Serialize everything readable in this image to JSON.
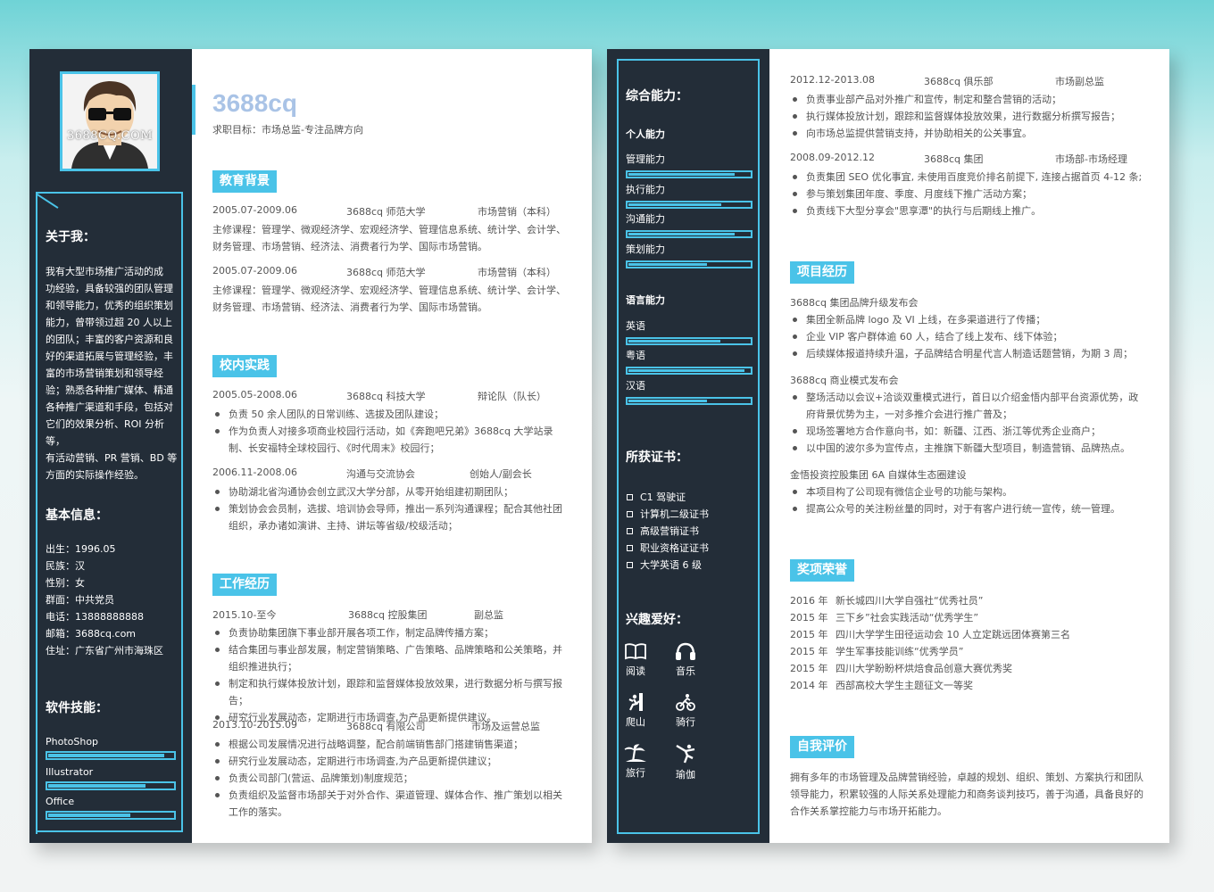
{
  "avatar": {
    "watermark": "3688CQ.COM"
  },
  "header": {
    "name": "3688cq",
    "objective": "求职目标：市场总监-专注品牌方向"
  },
  "about": {
    "title": "关于我：",
    "lines": [
      "我有大型市场推广活动的成",
      "功经验，具备较强的团队管理",
      "和领导能力，优秀的组织策划",
      "能力，曾带领过超 20 人以上",
      "的团队；丰富的客户资源和良",
      "好的渠道拓展与管理经验，丰",
      "富的市场营销策划和领导经",
      "验；熟悉各种推广媒体、精通",
      "各种推广渠道和手段，包括对",
      "它们的效果分析、ROI 分析等，",
      "有活动营销、PR 营销、BD 等",
      "方面的实际操作经验。"
    ]
  },
  "basic": {
    "title": "基本信息：",
    "lines": [
      "出生：1996.05",
      "民族：汉",
      "性别：女",
      "群面：中共党员",
      "电话：13888888888",
      "邮箱：3688cq.com",
      "住址：广东省广州市海珠区"
    ]
  },
  "software": {
    "title": "软件技能：",
    "items": [
      {
        "label": "PhotoShop",
        "level": 0.93
      },
      {
        "label": "Illustrator",
        "level": 0.78
      },
      {
        "label": "Office",
        "level": 0.66
      }
    ]
  },
  "education": {
    "title": "教育背景",
    "entries": [
      {
        "date": "2005.07-2009.06",
        "org": "3688cq 师范大学",
        "role": "市场营销（本科）",
        "lines": [
          "主修课程：管理学、微观经济学、宏观经济学、管理信息系统、统计学、会计学、",
          "财务管理、市场营销、经济法、消费者行为学、国际市场营销。"
        ]
      },
      {
        "date": "2005.07-2009.06",
        "org": "3688cq 师范大学",
        "role": "市场营销（本科）",
        "lines": [
          "主修课程：管理学、微观经济学、宏观经济学、管理信息系统、统计学、会计学、",
          "财务管理、市场营销、经济法、消费者行为学、国际市场营销。"
        ]
      }
    ]
  },
  "campus": {
    "title": "校内实践",
    "entries": [
      {
        "date": "2005.05-2008.06",
        "org": "3688cq 科技大学",
        "role": "辩论队（队长）",
        "bullets": [
          "负责 50 余人团队的日常训练、选拔及团队建设；",
          "作为负责人对接多项商业校园行活动，如《奔跑吧兄弟》3688cq 大学站录制、长安福特全球校园行、《时代周末》校园行；"
        ]
      },
      {
        "date": "2006.11-2008.06",
        "org": "沟通与交流协会",
        "role": "创始人/副会长",
        "bullets": [
          "协助湖北省沟通协会创立武汉大学分部，从零开始组建初期团队；",
          "策划协会会员制，选拔、培训协会导师，推出一系列沟通课程；配合其他社团组织，承办诸如演讲、主持、讲坛等省级/校级活动；"
        ]
      }
    ]
  },
  "work": {
    "title": "工作经历",
    "entries": [
      {
        "date": "2015.10-至今",
        "org": "3688cq 控股集团",
        "role": "副总监",
        "bullets": [
          "负责协助集团旗下事业部开展各项工作，制定品牌传播方案；",
          "结合集团与事业部发展，制定营销策略、广告策略、品牌策略和公关策略，并组织推进执行；",
          "制定和执行媒体投放计划，跟踪和监督媒体投放效果，进行数据分析与撰写报告；",
          "研究行业发展动态，定期进行市场调查,为产品更新提供建议。"
        ]
      },
      {
        "date": "2013.10-2015.09",
        "org": "3688cq 有限公司",
        "role": "市场及运营总监",
        "bullets": [
          "根据公司发展情况进行战略调整，配合前端销售部门搭建销售渠道；",
          "研究行业发展动态，定期进行市场调查,为产品更新提供建议；",
          "负责公司部门(营运、品牌策划)制度规范；",
          "负责组织及监督市场部关于对外合作、渠道管理、媒体合作、推广策划以相关工作的落实。"
        ]
      }
    ]
  },
  "work2": {
    "entries": [
      {
        "date": "2012.12-2013.08",
        "org": "3688cq 俱乐部",
        "role": "市场副总监",
        "bullets": [
          "负责事业部产品对外推广和宣传，制定和整合营销的活动；",
          "执行媒体投放计划，跟踪和监督媒体投放效果，进行数据分析撰写报告；",
          "向市场总监提供营销支持，并协助相关的公关事宜。"
        ]
      },
      {
        "date": "2008.09-2012.12",
        "org": "3688cq 集团",
        "role": "市场部-市场经理",
        "bullets": [
          "负责集团 SEO 优化事宜, 未使用百度竞价排名前提下, 连接占据首页 4-12 条;",
          "参与策划集团年度、季度、月度线下推广活动方案；",
          "负责线下大型分享会\"思享潭\"的执行与后期线上推广。"
        ]
      }
    ]
  },
  "projects": {
    "title": "项目经历",
    "entries": [
      {
        "name": "3688cq 集团品牌升级发布会",
        "bullets": [
          "集团全新品牌 logo 及 VI 上线，在多渠道进行了传播；",
          "企业 VIP 客户群体逾 60 人，结合了线上发布、线下体验；",
          "后续媒体报道持续升温，子品牌结合明星代言人制造话题营销，为期 3 周；"
        ]
      },
      {
        "name": "3688cq 商业模式发布会",
        "bullets": [
          "整场活动以会议+洽谈双重模式进行，首日以介绍金悟内部平台资源优势，政府背景优势为主，一对多推介会进行推广普及；",
          "现场签署地方合作意向书，如：新疆、江西、浙江等优秀企业商户；",
          "以中国的波尔多为宣传点，主推旗下新疆大型项目，制造营销、品牌热点。"
        ]
      },
      {
        "name": "金悟投资控股集团 6A 自媒体生态圈建设",
        "bullets": [
          "本项目构了公司现有微信企业号的功能与架构。",
          "提高公众号的关注粉丝量的同时，对于有客户进行统一宣传，统一管理。"
        ]
      }
    ]
  },
  "awards": {
    "title": "奖项荣誉",
    "items": [
      {
        "year": "2016 年",
        "text": "新长城四川大学自强社“优秀社员”"
      },
      {
        "year": "2015 年",
        "text": "三下乡”社会实践活动“优秀学生”"
      },
      {
        "year": "2015 年",
        "text": "四川大学学生田径运动会 10 人立定跳远团体赛第三名"
      },
      {
        "year": "2015 年",
        "text": "学生军事技能训练“优秀学员”"
      },
      {
        "year": "2015 年",
        "text": "四川大学盼盼杯烘焙食品创意大赛优秀奖"
      },
      {
        "year": "2014 年",
        "text": "西部高校大学生主题征文一等奖"
      }
    ]
  },
  "selfEval": {
    "title": "自我评价",
    "lines": [
      "拥有多年的市场管理及品牌营销经验，卓越的规划、组织、策划、方案执行和团队",
      "领导能力，积累较强的人际关系处理能力和商务谈判技巧，善于沟通，具备良好的",
      "合作关系掌控能力与市场开拓能力。"
    ]
  },
  "abilities": {
    "title": "综合能力：",
    "personal": {
      "title": "个人能力",
      "items": [
        {
          "label": "管理能力",
          "level": 0.88
        },
        {
          "label": "执行能力",
          "level": 0.77
        },
        {
          "label": "沟通能力",
          "level": 0.88
        },
        {
          "label": "策划能力",
          "level": 0.65
        }
      ]
    },
    "language": {
      "title": "语言能力",
      "items": [
        {
          "label": "英语",
          "level": 0.76
        },
        {
          "label": "粤语",
          "level": 0.96
        },
        {
          "label": "汉语",
          "level": 0.65
        }
      ]
    }
  },
  "certs": {
    "title": "所获证书：",
    "items": [
      "C1 驾驶证",
      "计算机二级证书",
      "高级营销证书",
      "职业资格证证书",
      "大学英语 6 级"
    ]
  },
  "hobbies": {
    "title": "兴趣爱好：",
    "items": [
      {
        "label": "阅读",
        "icon": "book-icon"
      },
      {
        "label": "音乐",
        "icon": "headphones-icon"
      },
      {
        "label": "爬山",
        "icon": "climbing-icon"
      },
      {
        "label": "骑行",
        "icon": "cycling-icon"
      },
      {
        "label": "旅行",
        "icon": "palm-tree-icon"
      },
      {
        "label": "瑜伽",
        "icon": "yoga-icon"
      }
    ]
  },
  "colors": {
    "accent": "#4ac3e8",
    "sidebar": "#232d38",
    "name": "#a9c3e6"
  }
}
